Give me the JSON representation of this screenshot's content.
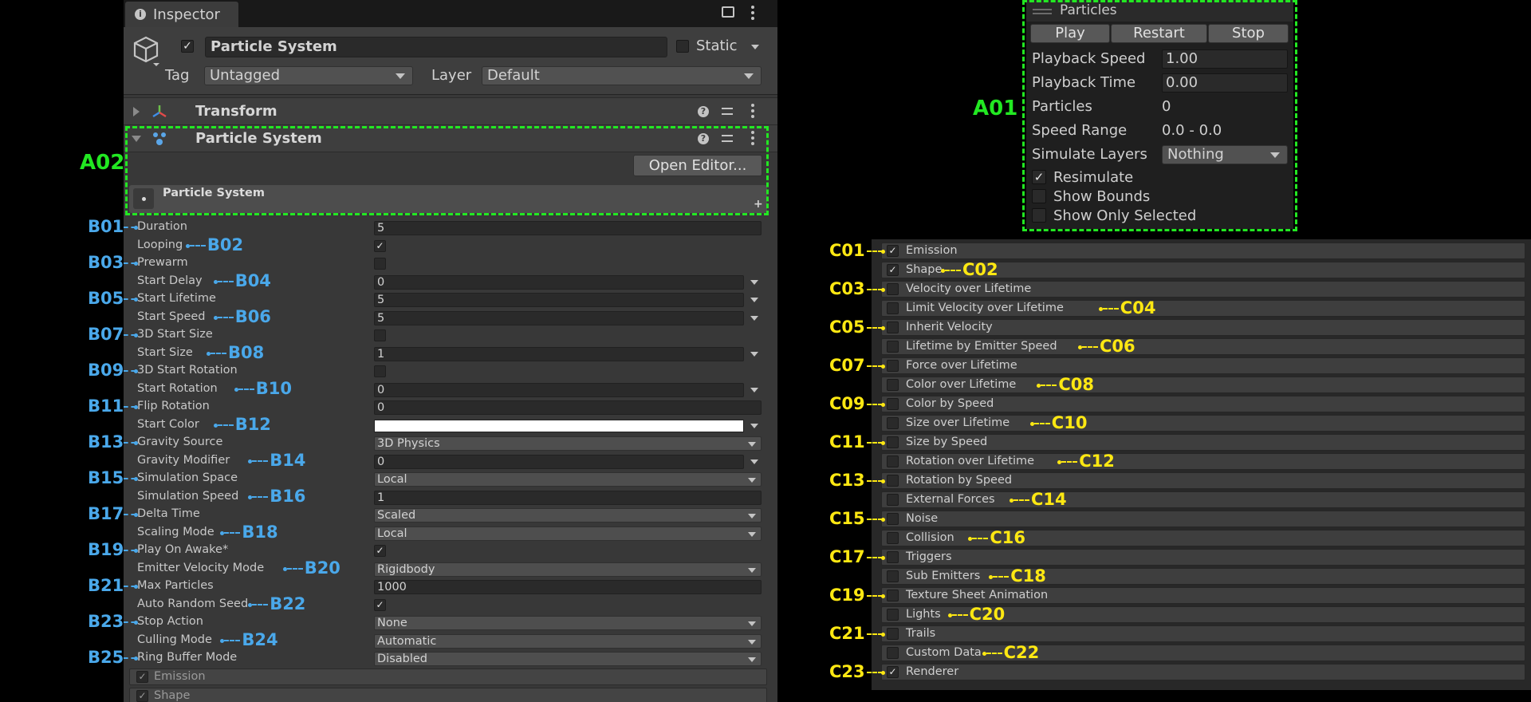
{
  "inspector": {
    "tab_label": "Inspector",
    "object_name": "Particle System",
    "static_label": "Static",
    "tag_label": "Tag",
    "tag_value": "Untagged",
    "layer_label": "Layer",
    "layer_value": "Default",
    "transform_title": "Transform",
    "ps_component_title": "Particle System",
    "open_editor_label": "Open Editor...",
    "ps_module_title": "Particle System",
    "plus_symbol": "+"
  },
  "main_properties": [
    {
      "label": "Duration",
      "kind": "field",
      "value": "5"
    },
    {
      "label": "Looping",
      "kind": "check",
      "checked": true
    },
    {
      "label": "Prewarm",
      "kind": "check",
      "checked": false
    },
    {
      "label": "Start Delay",
      "kind": "field_arrow",
      "value": "0"
    },
    {
      "label": "Start Lifetime",
      "kind": "field_arrow",
      "value": "5"
    },
    {
      "label": "Start Speed",
      "kind": "field_arrow",
      "value": "5"
    },
    {
      "label": "3D Start Size",
      "kind": "check",
      "checked": false
    },
    {
      "label": "Start Size",
      "kind": "field_arrow",
      "value": "1"
    },
    {
      "label": "3D Start Rotation",
      "kind": "check",
      "checked": false
    },
    {
      "label": "Start Rotation",
      "kind": "field_arrow",
      "value": "0"
    },
    {
      "label": "Flip Rotation",
      "kind": "field",
      "value": "0"
    },
    {
      "label": "Start Color",
      "kind": "color",
      "value": "#ffffff"
    },
    {
      "label": "Gravity Source",
      "kind": "dropdown",
      "value": "3D Physics"
    },
    {
      "label": "Gravity Modifier",
      "kind": "field_arrow",
      "value": "0"
    },
    {
      "label": "Simulation Space",
      "kind": "dropdown",
      "value": "Local"
    },
    {
      "label": "Simulation Speed",
      "kind": "field",
      "value": "1"
    },
    {
      "label": "Delta Time",
      "kind": "dropdown",
      "value": "Scaled"
    },
    {
      "label": "Scaling Mode",
      "kind": "dropdown",
      "value": "Local"
    },
    {
      "label": "Play On Awake*",
      "kind": "check",
      "checked": true
    },
    {
      "label": "Emitter Velocity Mode",
      "kind": "dropdown",
      "value": "Rigidbody"
    },
    {
      "label": "Max Particles",
      "kind": "field",
      "value": "1000"
    },
    {
      "label": "Auto Random Seed",
      "kind": "check",
      "checked": true
    },
    {
      "label": "Stop Action",
      "kind": "dropdown",
      "value": "None"
    },
    {
      "label": "Culling Mode",
      "kind": "dropdown",
      "value": "Automatic"
    },
    {
      "label": "Ring Buffer Mode",
      "kind": "dropdown",
      "value": "Disabled"
    }
  ],
  "inspector_bottom_modules": [
    {
      "label": "Emission",
      "checked": true
    },
    {
      "label": "Shape",
      "checked": true
    }
  ],
  "particles_overlay": {
    "title": "Particles",
    "buttons": [
      "Play",
      "Restart",
      "Stop"
    ],
    "playback_speed_label": "Playback Speed",
    "playback_speed_value": "1.00",
    "playback_time_label": "Playback Time",
    "playback_time_value": "0.00",
    "particles_label": "Particles",
    "particles_value": "0",
    "speed_range_label": "Speed Range",
    "speed_range_value": "0.0 - 0.0",
    "simulate_layers_label": "Simulate Layers",
    "simulate_layers_value": "Nothing",
    "resimulate_label": "Resimulate",
    "resimulate_checked": true,
    "show_bounds_label": "Show Bounds",
    "show_bounds_checked": false,
    "show_only_selected_label": "Show Only Selected",
    "show_only_selected_checked": false
  },
  "modules": [
    {
      "label": "Emission",
      "checked": true
    },
    {
      "label": "Shape",
      "checked": true
    },
    {
      "label": "Velocity over Lifetime",
      "checked": false
    },
    {
      "label": "Limit Velocity over Lifetime",
      "checked": false
    },
    {
      "label": "Inherit Velocity",
      "checked": false
    },
    {
      "label": "Lifetime by Emitter Speed",
      "checked": false
    },
    {
      "label": "Force over Lifetime",
      "checked": false
    },
    {
      "label": "Color over Lifetime",
      "checked": false
    },
    {
      "label": "Color by Speed",
      "checked": false
    },
    {
      "label": "Size over Lifetime",
      "checked": false
    },
    {
      "label": "Size by Speed",
      "checked": false
    },
    {
      "label": "Rotation over Lifetime",
      "checked": false
    },
    {
      "label": "Rotation by Speed",
      "checked": false
    },
    {
      "label": "External Forces",
      "checked": false
    },
    {
      "label": "Noise",
      "checked": false
    },
    {
      "label": "Collision",
      "checked": false
    },
    {
      "label": "Triggers",
      "checked": false
    },
    {
      "label": "Sub Emitters",
      "checked": false
    },
    {
      "label": "Texture Sheet Animation",
      "checked": false
    },
    {
      "label": "Lights",
      "checked": false
    },
    {
      "label": "Trails",
      "checked": false
    },
    {
      "label": "Custom Data",
      "checked": false
    },
    {
      "label": "Renderer",
      "checked": true
    }
  ],
  "annotations": {
    "a_labels": [
      "A01",
      "A02"
    ],
    "b_labels": [
      "B01",
      "B02",
      "B03",
      "B04",
      "B05",
      "B06",
      "B07",
      "B08",
      "B09",
      "B10",
      "B11",
      "B12",
      "B13",
      "B14",
      "B15",
      "B16",
      "B17",
      "B18",
      "B19",
      "B20",
      "B21",
      "B22",
      "B23",
      "B24",
      "B25"
    ],
    "c_labels": [
      "C01",
      "C02",
      "C03",
      "C04",
      "C05",
      "C06",
      "C07",
      "C08",
      "C09",
      "C10",
      "C11",
      "C12",
      "C13",
      "C14",
      "C15",
      "C16",
      "C17",
      "C18",
      "C19",
      "C20",
      "C21",
      "C22",
      "C23"
    ],
    "colors": {
      "a": "#22e822",
      "b": "#4aa8ea",
      "c": "#ffe812"
    }
  }
}
